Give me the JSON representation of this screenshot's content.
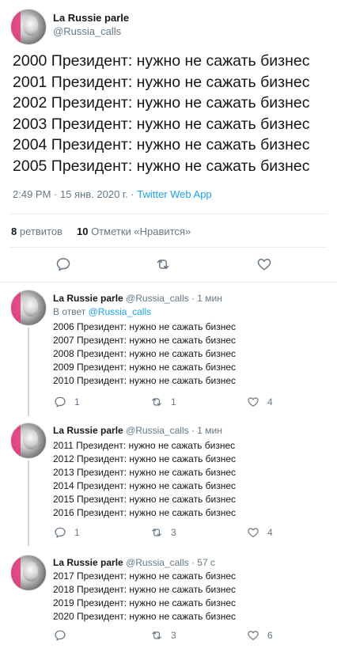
{
  "main_tweet": {
    "name": "La Russie parle",
    "handle": "@Russia_calls",
    "lines": [
      "2000 Президент: нужно не сажать бизнес",
      "2001 Президент: нужно не сажать бизнес",
      "2002 Президент: нужно не сажать бизнес",
      "2003 Президент: нужно не сажать бизнес",
      "2004 Президент: нужно не сажать бизнес",
      "2005 Президент: нужно не сажать бизнес"
    ],
    "timestamp": "2:49 PM · 15 янв. 2020 г. · ",
    "source_app": "Twitter Web App",
    "retweets_count": "8",
    "retweets_label": "ретвитов",
    "likes_count": "10",
    "likes_label": "Отметки «Нравится»"
  },
  "replies": [
    {
      "name": "La Russie parle",
      "handle": "@Russia_calls · 1 мин",
      "reply_to_prefix": "В ответ ",
      "reply_to_handle": "@Russia_calls",
      "lines": [
        "2006 Президент: нужно не сажать бизнес",
        "2007 Президент: нужно не сажать бизнес",
        "2008 Президент: нужно не сажать бизнес",
        "2009 Президент: нужно не сажать бизнес",
        "2010 Президент: нужно не сажать бизнес"
      ],
      "reply_count": "1",
      "retweet_count": "1",
      "like_count": "4"
    },
    {
      "name": "La Russie parle",
      "handle": "@Russia_calls · 1 мин",
      "lines": [
        "2011 Президент: нужно не сажать бизнес",
        "2012 Президент: нужно не сажать бизнес",
        "2013 Президент: нужно не сажать бизнес",
        "2014 Президент: нужно не сажать бизнес",
        "2015 Президент: нужно не сажать бизнес",
        "2016 Президент: нужно не сажать бизнес"
      ],
      "reply_count": "1",
      "retweet_count": "3",
      "like_count": "4"
    },
    {
      "name": "La Russie parle",
      "handle": "@Russia_calls · 57 с",
      "lines": [
        "2017 Президент: нужно не сажать бизнес",
        "2018 Президент: нужно не сажать бизнес",
        "2019 Президент: нужно не сажать бизнес",
        "2020 Президент: нужно не сажать бизнес"
      ],
      "reply_count": "",
      "retweet_count": "3",
      "like_count": "6"
    }
  ],
  "icons": {
    "reply": "reply-icon",
    "retweet": "retweet-icon",
    "like": "heart-icon"
  },
  "colors": {
    "accent": "#1da1f2",
    "muted": "#657786",
    "text": "#14171a",
    "divider": "#e6ecf0"
  }
}
